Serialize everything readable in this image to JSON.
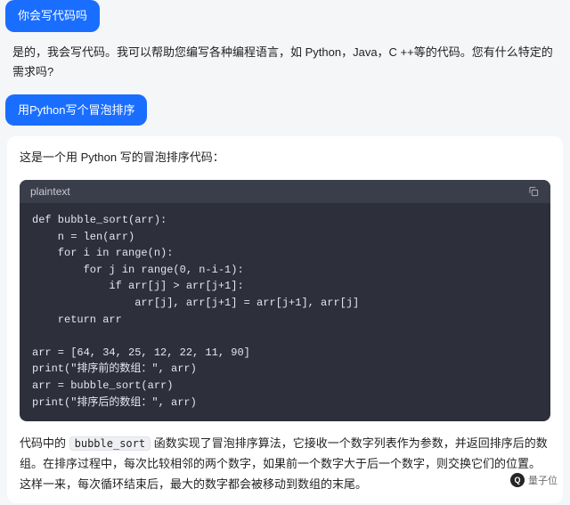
{
  "messages": {
    "user1": "你会写代码吗",
    "assistant1": "是的，我会写代码。我可以帮助您编写各种编程语言，如 Python，Java，C ++等的代码。您有什么特定的需求吗?",
    "user2": "用Python写个冒泡排序",
    "assistant2_intro": "这是一个用 Python 写的冒泡排序代码：",
    "code_lang": "plaintext",
    "code": "def bubble_sort(arr):\n    n = len(arr)\n    for i in range(n):\n        for j in range(0, n-i-1):\n            if arr[j] > arr[j+1]:\n                arr[j], arr[j+1] = arr[j+1], arr[j]\n    return arr\n\narr = [64, 34, 25, 12, 22, 11, 90]\nprint(\"排序前的数组：\", arr)\narr = bubble_sort(arr)\nprint(\"排序后的数组：\", arr)",
    "explain_pre": "代码中的 ",
    "explain_code": "bubble_sort",
    "explain_post": " 函数实现了冒泡排序算法，它接收一个数字列表作为参数，并返回排序后的数组。在排序过程中，每次比较相邻的两个数字，如果前一个数字大于后一个数字，则交换它们的位置。这样一来，每次循环结束后，最大的数字都会被移动到数组的末尾。"
  },
  "watermark": {
    "logo_text": "Q",
    "label": "量子位"
  }
}
